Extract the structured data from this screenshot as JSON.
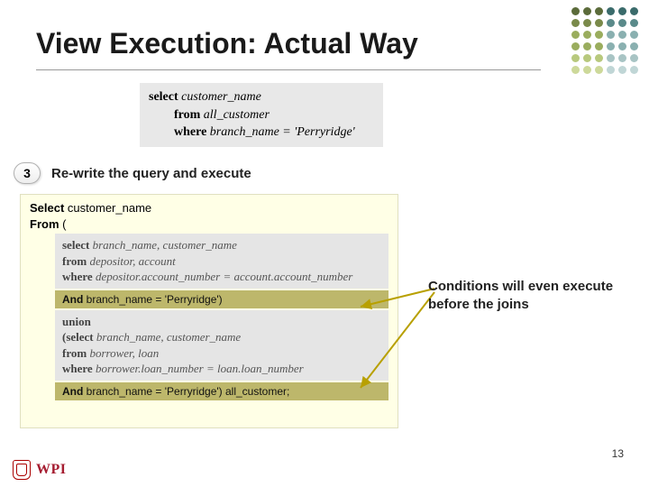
{
  "slide": {
    "title": "View Execution: Actual Way",
    "page_number": "13"
  },
  "top_query": {
    "l1_kw": "select",
    "l1_rest": " customer_name",
    "l2_kw": "from",
    "l2_rest": " all_customer",
    "l3_kw": "where",
    "l3_rest": " branch_name = 'Perryridge'"
  },
  "step": {
    "num": "3",
    "label": "Re-write the query and execute"
  },
  "rewrite": {
    "l1_kw": "Select",
    "l1_rest": " customer_name",
    "l2_kw": "From",
    "l2_rest": " (",
    "sub1": {
      "a_kw": "select",
      "a_rest": " branch_name, customer_name",
      "b_kw": "from",
      "b_rest": " depositor, account",
      "c_kw": "where",
      "c_rest": " depositor.account_number = account.account_number"
    },
    "olive1_kw": "And",
    "olive1_rest": " branch_name = 'Perryridge')",
    "union": "union",
    "sub2": {
      "a_kw": "(select",
      "a_rest": " branch_name, customer_name",
      "b_kw": "from",
      "b_rest": " borrower, loan",
      "c_kw": "where",
      "c_rest": " borrower.loan_number = loan.loan_number"
    },
    "olive2_kw": "And",
    "olive2_rest": " branch_name = 'Perryridge')  all_customer;"
  },
  "callout": "Conditions will even execute before the joins",
  "logo": {
    "text": "WPI"
  },
  "dot_colors": {
    "r1": "#5b6b3a",
    "r2": "#7a8a4a",
    "r3": "#9aad5e",
    "r4": "#3a6b6b",
    "r5": "#5a8a8a",
    "r6": "#8ab0b0"
  }
}
